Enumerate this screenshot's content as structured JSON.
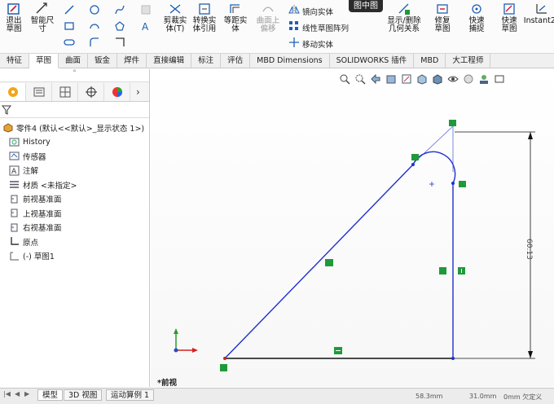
{
  "ribbon": {
    "tooltip": "图中图",
    "buttons": {
      "exit_sketch": "退出草图",
      "smart_dim": "智能尺寸",
      "trim": "剪裁实体(T)",
      "convert": "转换实体引用",
      "offset": "等距实体",
      "surface": "曲面上偏移",
      "show_delete": "显示/删除几何关系",
      "repair": "修复草图",
      "quick_snap": "快速捕捉",
      "quick_sketch": "快速草图",
      "instant": "Instant2D"
    },
    "texts": {
      "mirror": "镜向实体",
      "linear_pattern": "线性草图阵列",
      "move": "移动实体"
    }
  },
  "tabs": [
    "特征",
    "草图",
    "曲面",
    "钣金",
    "焊件",
    "直接编辑",
    "标注",
    "评估",
    "MBD Dimensions",
    "SOLIDWORKS 插件",
    "MBD",
    "大工程师"
  ],
  "active_tab": "草图",
  "panel": {
    "collapse_symbol": "°",
    "tree": [
      {
        "label": "零件4 (默认<<默认>_显示状态 1>)",
        "icon": "part-icon"
      },
      {
        "label": "History",
        "icon": "history-icon"
      },
      {
        "label": "传感器",
        "icon": "sensor-icon"
      },
      {
        "label": "注解",
        "icon": "annotation-icon"
      },
      {
        "label": "材质 <未指定>",
        "icon": "material-icon"
      },
      {
        "label": "前视基准面",
        "icon": "plane-icon"
      },
      {
        "label": "上视基准面",
        "icon": "plane-icon"
      },
      {
        "label": "右视基准面",
        "icon": "plane-icon"
      },
      {
        "label": "原点",
        "icon": "origin-icon"
      },
      {
        "label": "(-) 草图1",
        "icon": "sketch-icon"
      }
    ]
  },
  "viewport": {
    "view_name": "*前视",
    "dimension_text": "60.13"
  },
  "bottom_tabs": [
    "模型",
    "3D 视图",
    "运动算例 1"
  ],
  "status": [
    "58.3mm",
    "31.0mm",
    "0mm 欠定义"
  ],
  "colors": {
    "sketch_line": "#1f2fd0",
    "relation_marker": "#1e9a3a",
    "dimension": "#111111"
  }
}
